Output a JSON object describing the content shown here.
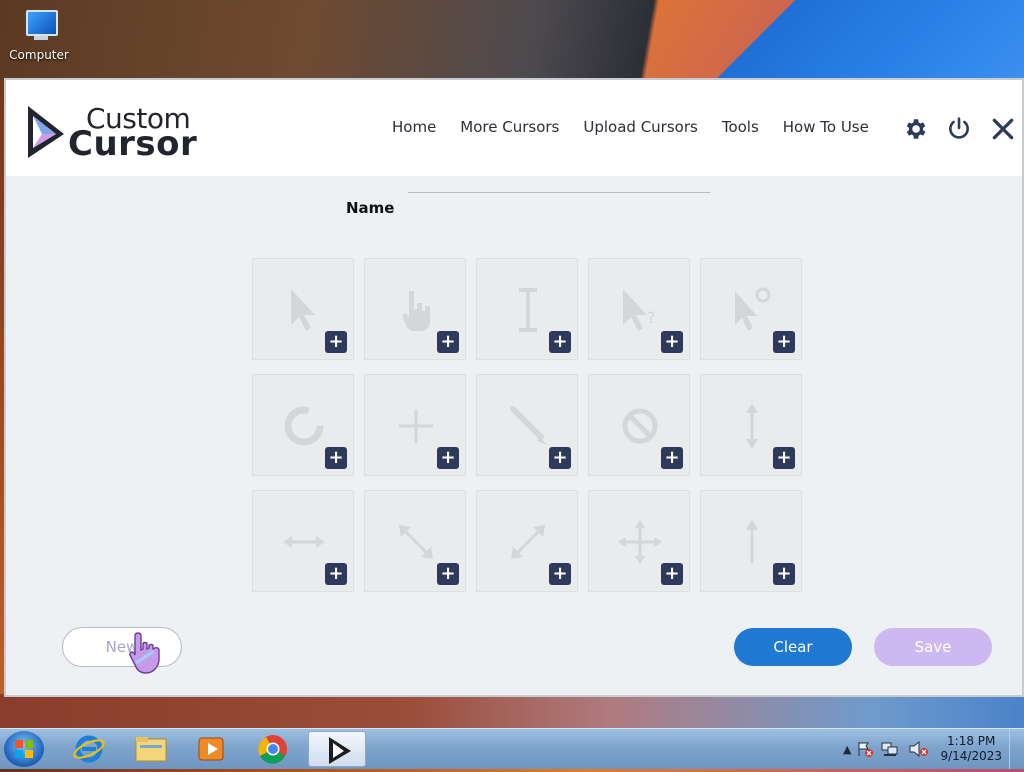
{
  "desktop": {
    "icons": [
      {
        "label": "Computer",
        "icon": "computer-icon"
      }
    ]
  },
  "app": {
    "logo": {
      "line1": "Custom",
      "line2": "Cursor"
    },
    "nav": [
      "Home",
      "More Cursors",
      "Upload Cursors",
      "Tools",
      "How To Use"
    ],
    "header_icons": [
      "gear-icon",
      "power-icon",
      "close-icon"
    ],
    "form": {
      "name_label": "Name",
      "name_value": ""
    },
    "cursor_slots": [
      "normal-select",
      "link-select",
      "text-select",
      "help-select",
      "working-in-background",
      "busy",
      "precision-select",
      "handwriting",
      "unavailable",
      "vertical-resize",
      "horizontal-resize",
      "diagonal-resize-1",
      "diagonal-resize-2",
      "move",
      "alternate-select"
    ],
    "plus_symbol": "+",
    "buttons": {
      "new": "New",
      "clear": "Clear",
      "save": "Save"
    },
    "colors": {
      "clear": "#1f78d1",
      "save": "#cdb9ef",
      "plus_badge": "#2e3a5c"
    }
  },
  "taskbar": {
    "apps": [
      "internet-explorer-icon",
      "file-explorer-icon",
      "media-player-icon",
      "chrome-icon",
      "custom-cursor-icon"
    ],
    "time": "1:18 PM",
    "date": "9/14/2023",
    "tray_arrow": "▲"
  }
}
